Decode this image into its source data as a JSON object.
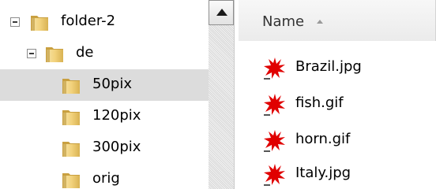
{
  "tree": {
    "items": [
      {
        "label": "folder-2",
        "expanded": true,
        "selected": false,
        "has_expander": true
      },
      {
        "label": "de",
        "expanded": true,
        "selected": false,
        "has_expander": true
      },
      {
        "label": "50pix",
        "expanded": false,
        "selected": true,
        "has_expander": false
      },
      {
        "label": "120pix",
        "expanded": false,
        "selected": false,
        "has_expander": false
      },
      {
        "label": "300pix",
        "expanded": false,
        "selected": false,
        "has_expander": false
      },
      {
        "label": "orig",
        "expanded": false,
        "selected": false,
        "has_expander": false
      }
    ]
  },
  "scrollbar": {
    "up_icon": "scroll-up-arrow-icon"
  },
  "list": {
    "column_header": "Name",
    "sort": "ascending",
    "files": [
      {
        "name": "Brazil.jpg",
        "icon": "image-file-icon"
      },
      {
        "name": "fish.gif",
        "icon": "image-file-icon"
      },
      {
        "name": "horn.gif",
        "icon": "image-file-icon"
      },
      {
        "name": "Italy.jpg",
        "icon": "image-file-icon"
      }
    ]
  },
  "colors": {
    "selection": "#dcdcdc",
    "folder": "#e8c66a",
    "file_icon": "#e00000"
  }
}
